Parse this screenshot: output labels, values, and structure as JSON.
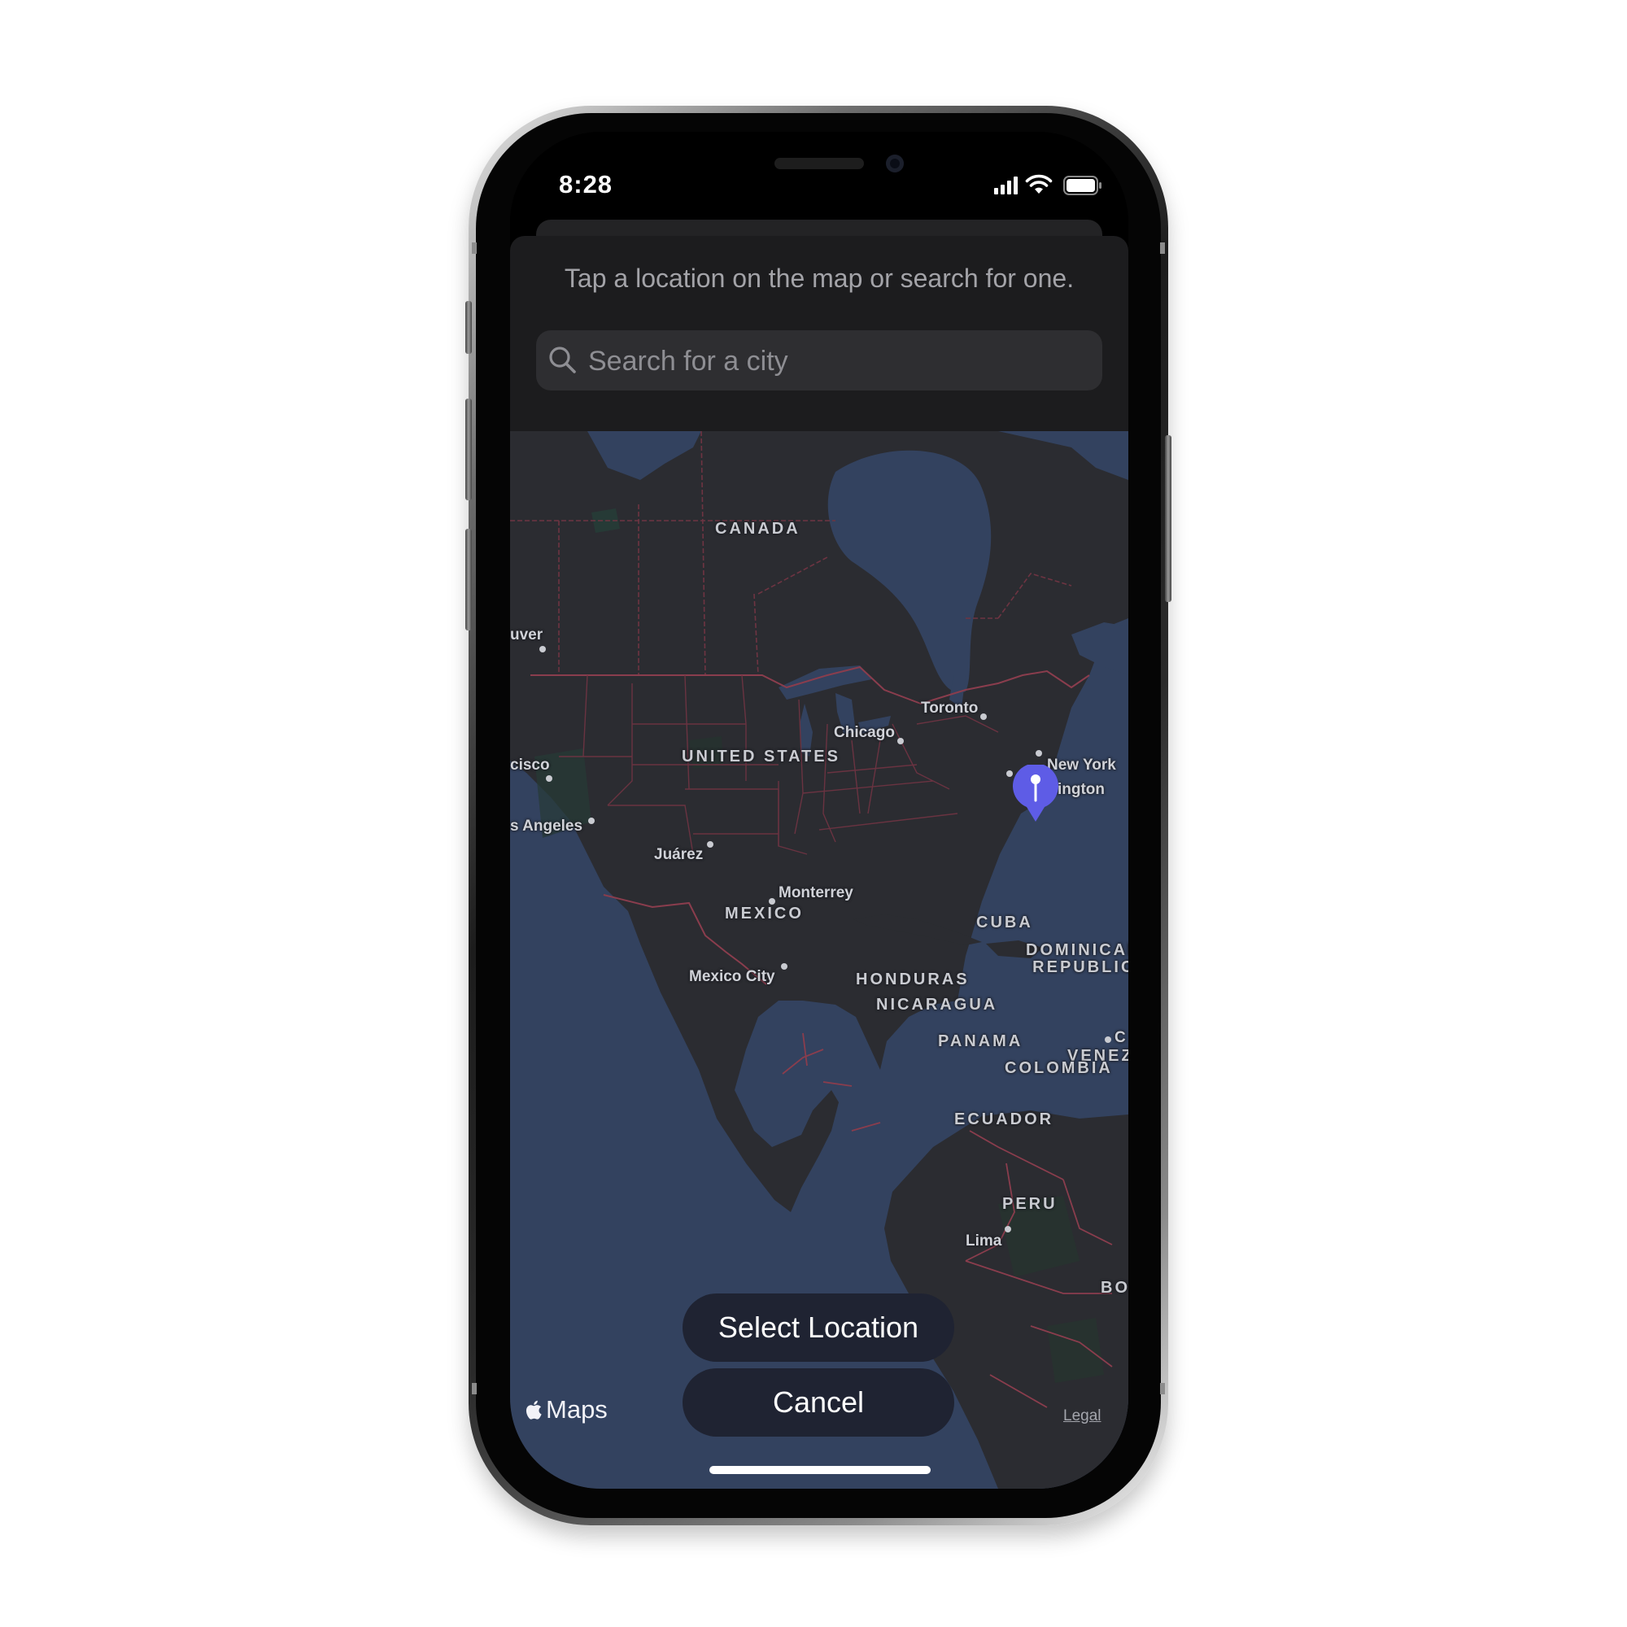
{
  "status_bar": {
    "time": "8:28",
    "signal_icon": "cellular-signal-icon",
    "wifi_icon": "wifi-icon",
    "battery_icon": "battery-full-icon"
  },
  "sheet": {
    "instruction": "Tap a location on the map or search for one.",
    "search": {
      "placeholder": "Search for a city",
      "value": "",
      "icon": "magnifying-glass-icon"
    }
  },
  "map": {
    "countries": {
      "canada": "CANADA",
      "united_states": "UNITED STATES",
      "mexico": "MEXICO",
      "cuba": "CUBA",
      "dominican_republic_1": "DOMINICAN",
      "dominican_republic_2": "REPUBLIC",
      "honduras": "HONDURAS",
      "nicaragua": "NICARAGUA",
      "panama": "PANAMA",
      "venezuela": "VENEZU",
      "colombia": "COLOMBIA",
      "ecuador": "ECUADOR",
      "peru": "PERU",
      "bolivia": "BO"
    },
    "cities": {
      "vancouver": "uver",
      "san_francisco": "cisco",
      "los_angeles": "s Angeles",
      "juarez": "Juárez",
      "monterrey": "Monterrey",
      "mexico_city": "Mexico City",
      "chicago": "Chicago",
      "toronto": "Toronto",
      "new_york": "New York",
      "washington": "Washington",
      "caracas": "C",
      "lima": "Lima"
    },
    "pin_icon": "map-pin-icon",
    "pin_color": "#5e5ce6",
    "water_color": "#33425f",
    "land_color": "#2b2c31",
    "border_color": "#7a3a48",
    "attribution": "Maps",
    "legal": "Legal"
  },
  "actions": {
    "select_label": "Select Location",
    "cancel_label": "Cancel"
  }
}
